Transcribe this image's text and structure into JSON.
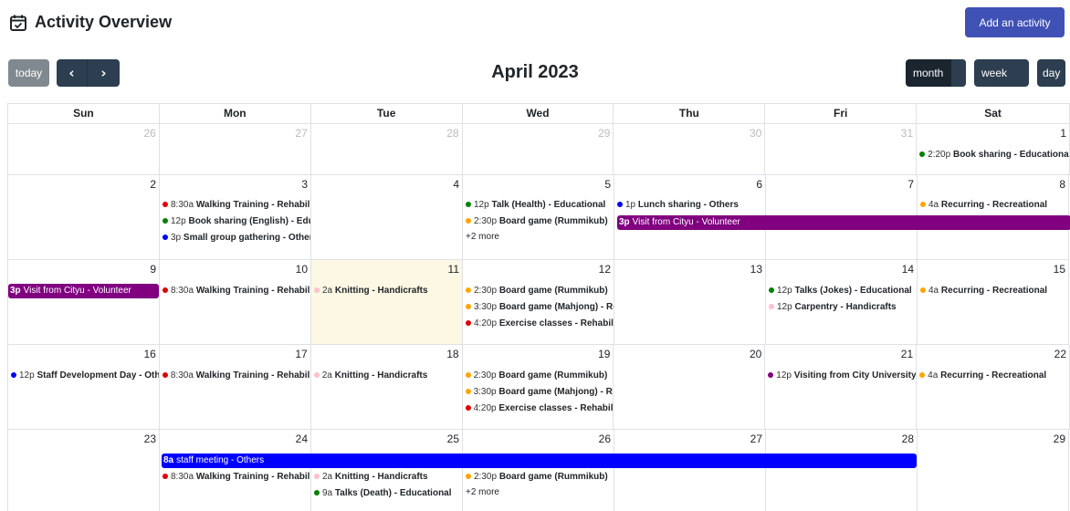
{
  "header": {
    "title": "Activity Overview",
    "add_button": "Add an activity"
  },
  "toolbar": {
    "today": "today",
    "prev": "‹",
    "next": "›",
    "month_title": "April 2023",
    "views": {
      "month": "month",
      "week": "week",
      "day": "day"
    }
  },
  "colors": {
    "red": "#e00000",
    "green": "#008000",
    "blue": "#0000ff",
    "orange": "#ffa500",
    "pink": "#ffc0cb",
    "purple": "#800080",
    "today_bg": "#fcf8e3",
    "primary": "#4051b5",
    "nav": "#2c3e50"
  },
  "days_of_week": [
    "Sun",
    "Mon",
    "Tue",
    "Wed",
    "Thu",
    "Fri",
    "Sat"
  ],
  "weeks": [
    {
      "days": [
        "26",
        "27",
        "28",
        "29",
        "30",
        "31",
        "1"
      ]
    },
    {
      "days": [
        "2",
        "3",
        "4",
        "5",
        "6",
        "7",
        "8"
      ]
    },
    {
      "days": [
        "9",
        "10",
        "11",
        "12",
        "13",
        "14",
        "15"
      ]
    },
    {
      "days": [
        "16",
        "17",
        "18",
        "19",
        "20",
        "21",
        "22"
      ]
    },
    {
      "days": [
        "23",
        "24",
        "25",
        "26",
        "27",
        "28",
        "29"
      ]
    }
  ],
  "events": {
    "w0_sat_1": {
      "time": "2:20p",
      "title": "Book sharing - Educational"
    },
    "w1_mon_1": {
      "time": "8:30a",
      "title": "Walking Training - Rehabilitation"
    },
    "w1_mon_2": {
      "time": "12p",
      "title": "Book sharing (English) - Educational"
    },
    "w1_mon_3": {
      "time": "3p",
      "title": "Small group gathering - Others"
    },
    "w1_wed_1": {
      "time": "12p",
      "title": "Talk (Health) - Educational"
    },
    "w1_wed_2": {
      "time": "2:30p",
      "title": "Board game (Rummikub)"
    },
    "w1_wed_more": "+2 more",
    "w1_thu_1": {
      "time": "1p",
      "title": "Lunch sharing - Others"
    },
    "w1_sat_1": {
      "time": "4a",
      "title": "Recurring - Recreational"
    },
    "w1_bar": {
      "time": "3p",
      "title": "Visit from Cityu - Volunteer"
    },
    "w2_bar": {
      "time": "3p",
      "title": "Visit from Cityu - Volunteer"
    },
    "w2_mon_1": {
      "time": "8:30a",
      "title": "Walking Training - Rehabilitation"
    },
    "w2_tue_1": {
      "time": "2a",
      "title": "Knitting - Handicrafts"
    },
    "w2_wed_1": {
      "time": "2:30p",
      "title": "Board game (Rummikub)"
    },
    "w2_wed_2": {
      "time": "3:30p",
      "title": "Board game (Mahjong) - Recreational"
    },
    "w2_wed_3": {
      "time": "4:20p",
      "title": "Exercise classes - Rehabilitation"
    },
    "w2_fri_1": {
      "time": "12p",
      "title": "Talks (Jokes) - Educational"
    },
    "w2_fri_2": {
      "time": "12p",
      "title": "Carpentry - Handicrafts"
    },
    "w2_sat_1": {
      "time": "4a",
      "title": "Recurring - Recreational"
    },
    "w3_sun_1": {
      "time": "12p",
      "title": "Staff Development Day - Others"
    },
    "w3_mon_1": {
      "time": "8:30a",
      "title": "Walking Training - Rehabilitation"
    },
    "w3_tue_1": {
      "time": "2a",
      "title": "Knitting - Handicrafts"
    },
    "w3_wed_1": {
      "time": "2:30p",
      "title": "Board game (Rummikub)"
    },
    "w3_wed_2": {
      "time": "3:30p",
      "title": "Board game (Mahjong) - Recreational"
    },
    "w3_wed_3": {
      "time": "4:20p",
      "title": "Exercise classes - Rehabilitation"
    },
    "w3_fri_1": {
      "time": "12p",
      "title": "Visiting from City University"
    },
    "w3_sat_1": {
      "time": "4a",
      "title": "Recurring - Recreational"
    },
    "w4_bar": {
      "time": "8a",
      "title": "staff meeting - Others"
    },
    "w4_mon_1": {
      "time": "8:30a",
      "title": "Walking Training - Rehabilitation"
    },
    "w4_tue_1": {
      "time": "2a",
      "title": "Knitting - Handicrafts"
    },
    "w4_tue_2": {
      "time": "9a",
      "title": "Talks (Death) - Educational"
    },
    "w4_wed_1": {
      "time": "2:30p",
      "title": "Board game (Rummikub)"
    },
    "w4_wed_more": "+2 more"
  }
}
